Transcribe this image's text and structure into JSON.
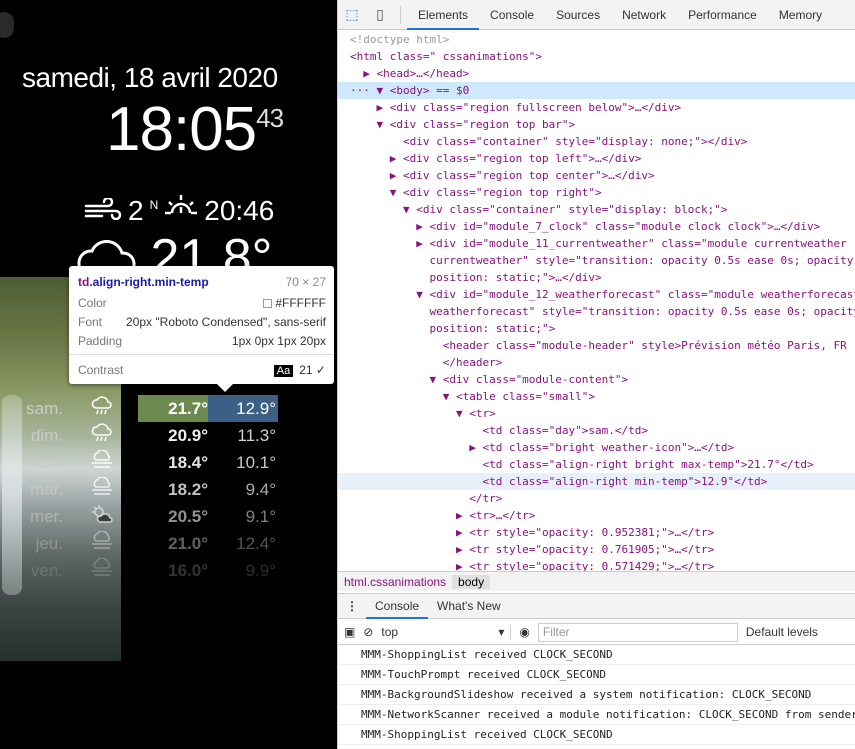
{
  "mirror": {
    "date": "samedi, 18 avril 2020",
    "time_hm": "18:05",
    "time_s": "43",
    "wind_speed": "2",
    "wind_dir": "N",
    "sunset": "20:46",
    "current_temp": "21.8°",
    "forecast": [
      {
        "day": "sam.",
        "icon": "rain-cloud-icon",
        "max": "21.7°",
        "min": "12.9°",
        "opacity": 1
      },
      {
        "day": "dim.",
        "icon": "rain-cloud-icon",
        "max": "20.9°",
        "min": "11.3°",
        "opacity": 0.95
      },
      {
        "day": "lun.",
        "icon": "fog-cloud-icon",
        "max": "18.4°",
        "min": "10.1°",
        "opacity": 0.9
      },
      {
        "day": "mar.",
        "icon": "fog-cloud-icon",
        "max": "18.2°",
        "min": "9.4°",
        "opacity": 0.76
      },
      {
        "day": "mer.",
        "icon": "partly-cloudy-icon",
        "max": "20.5°",
        "min": "9.1°",
        "opacity": 0.57
      },
      {
        "day": "jeu.",
        "icon": "fog-cloud-icon",
        "max": "21.0°",
        "min": "12.4°",
        "opacity": 0.38
      },
      {
        "day": "ven.",
        "icon": "fog-cloud-icon",
        "max": "16.0°",
        "min": "9.9°",
        "opacity": 0.2
      }
    ]
  },
  "tooltip": {
    "tag": "td",
    "cls": ".align-right.min-temp",
    "size": "70 × 27",
    "color_label": "Color",
    "color_value": "#FFFFFF",
    "font_label": "Font",
    "font_value": "20px \"Roboto Condensed\", sans-serif",
    "padding_label": "Padding",
    "padding_value": "1px 0px 1px 20px",
    "contrast_label": "Contrast",
    "contrast_aa": "Aa",
    "contrast_value": "21 ✓"
  },
  "devtools": {
    "tabs": [
      "Elements",
      "Console",
      "Sources",
      "Network",
      "Performance",
      "Memory"
    ],
    "active_tab": "Elements",
    "dom_lines": [
      "<!doctype html>",
      "<html class=\" cssanimations\">",
      "  ▶ <head>…</head>",
      "··· ▼ <body> == $0",
      "    ▶ <div class=\"region fullscreen below\">…</div>",
      "    ▼ <div class=\"region top bar\">",
      "        <div class=\"container\" style=\"display: none;\"></div>",
      "      ▶ <div class=\"region top left\">…</div>",
      "      ▶ <div class=\"region top center\">…</div>",
      "      ▼ <div class=\"region top right\">",
      "        ▼ <div class=\"container\" style=\"display: block;\">",
      "          ▶ <div id=\"module_7_clock\" class=\"module clock clock\">…</div>",
      "          ▶ <div id=\"module_11_currentweather\" class=\"module currentweather",
      "            currentweather\" style=\"transition: opacity 0.5s ease 0s; opacity: 1;",
      "            position: static;\">…</div>",
      "          ▼ <div id=\"module_12_weatherforecast\" class=\"module weatherforecast",
      "            weatherforecast\" style=\"transition: opacity 0.5s ease 0s; opacity: 1;",
      "            position: static;\">",
      "              <header class=\"module-header\" style>Prévision météo Paris, FR",
      "              </header>",
      "            ▼ <div class=\"module-content\">",
      "              ▼ <table class=\"small\">",
      "                ▼ <tr>",
      "                    <td class=\"day\">sam.</td>",
      "                  ▶ <td class=\"bright weather-icon\">…</td>",
      "                    <td class=\"align-right bright max-temp\">21.7°</td>",
      "                    <td class=\"align-right min-temp\">12.9°</td>",
      "                  </tr>",
      "                ▶ <tr>…</tr>",
      "                ▶ <tr style=\"opacity: 0.952381;\">…</tr>",
      "                ▶ <tr style=\"opacity: 0.761905;\">…</tr>",
      "                ▶ <tr style=\"opacity: 0.571429;\">…</tr>"
    ],
    "breadcrumbs": [
      "html.cssanimations",
      "body"
    ],
    "console_tabs": [
      "Console",
      "What's New"
    ],
    "context": "top",
    "filter_placeholder": "Filter",
    "levels": "Default levels",
    "logs": [
      "MMM-ShoppingList received CLOCK_SECOND",
      "MMM-TouchPrompt received CLOCK_SECOND",
      "MMM-BackgroundSlideshow received a system notification: CLOCK_SECOND",
      "MMM-NetworkScanner received a module notification: CLOCK_SECOND from sender: clock",
      "MMM-ShoppingList received CLOCK_SECOND",
      "MMM-TouchPrompt received CLOCK_SECOND"
    ]
  }
}
